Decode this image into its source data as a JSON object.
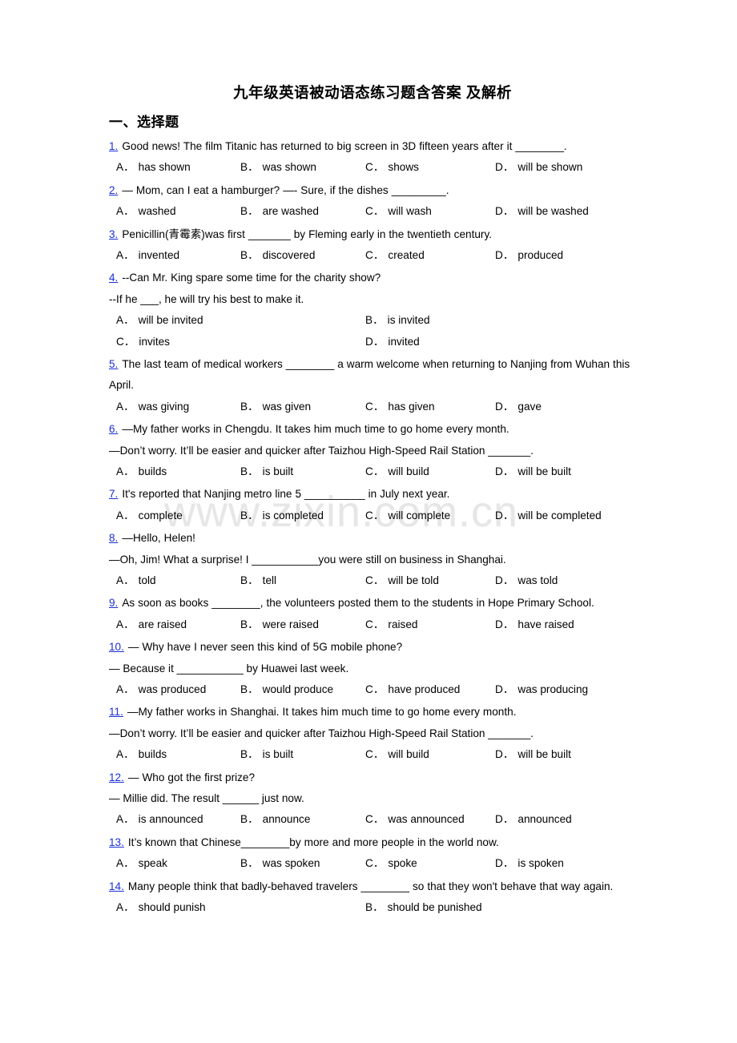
{
  "document": {
    "title": "九年级英语被动语态练习题含答案  及解析",
    "section_heading": "一、选择题",
    "watermark": "www.zixin.com.cn",
    "number_color": "#1b2fd6"
  },
  "questions": [
    {
      "number": "1.",
      "stem": "Good news! The film Titanic has returned to big screen in 3D fifteen years after it ________.",
      "continuation": null,
      "layout": "four-col",
      "options": [
        {
          "label": "A．",
          "text": "has shown"
        },
        {
          "label": "B．",
          "text": "was shown"
        },
        {
          "label": "C．",
          "text": "shows"
        },
        {
          "label": "D．",
          "text": "will be shown"
        }
      ]
    },
    {
      "number": "2.",
      "stem": "— Mom, can I eat a hamburger? —- Sure, if the dishes _________.",
      "continuation": null,
      "layout": "four-col",
      "options": [
        {
          "label": "A．",
          "text": "washed"
        },
        {
          "label": "B．",
          "text": "are washed"
        },
        {
          "label": "C．",
          "text": "will wash"
        },
        {
          "label": "D．",
          "text": "will be washed"
        }
      ]
    },
    {
      "number": "3.",
      "stem": "Penicillin(青霉素)was first _______ by Fleming early in the twentieth century.",
      "continuation": null,
      "layout": "four-col",
      "options": [
        {
          "label": "A．",
          "text": "invented"
        },
        {
          "label": "B．",
          "text": "discovered"
        },
        {
          "label": "C．",
          "text": "created"
        },
        {
          "label": "D．",
          "text": "produced"
        }
      ]
    },
    {
      "number": "4.",
      "stem": "--Can Mr. King spare some time for the charity show?",
      "continuation": "--If he ___, he will try his best to make it.",
      "layout": "two-col",
      "options": [
        {
          "label": "A．",
          "text": "will be invited"
        },
        {
          "label": "B．",
          "text": "is invited"
        },
        {
          "label": "C．",
          "text": "invites"
        },
        {
          "label": "D．",
          "text": "invited"
        }
      ]
    },
    {
      "number": "5.",
      "stem": "The last team of medical workers ________ a warm welcome when returning to Nanjing from Wuhan this April.",
      "continuation": null,
      "layout": "four-col",
      "options": [
        {
          "label": "A．",
          "text": "was giving"
        },
        {
          "label": "B．",
          "text": "was given"
        },
        {
          "label": "C．",
          "text": "has given"
        },
        {
          "label": "D．",
          "text": "gave"
        }
      ]
    },
    {
      "number": "6.",
      "stem": "—My father works in Chengdu. It takes him much time to go home every month.",
      "continuation": "—Don’t worry. It’ll be easier and quicker after Taizhou High-Speed Rail Station _______.",
      "layout": "four-col",
      "options": [
        {
          "label": "A．",
          "text": "builds"
        },
        {
          "label": "B．",
          "text": "is built"
        },
        {
          "label": "C．",
          "text": "will build"
        },
        {
          "label": "D．",
          "text": "will be built"
        }
      ]
    },
    {
      "number": "7.",
      "stem": "It's reported that Nanjing metro line 5 __________ in July next year.",
      "continuation": null,
      "layout": "four-col",
      "options": [
        {
          "label": "A．",
          "text": "complete"
        },
        {
          "label": "B．",
          "text": "is completed"
        },
        {
          "label": "C．",
          "text": "will complete"
        },
        {
          "label": "D．",
          "text": "will be completed"
        }
      ]
    },
    {
      "number": "8.",
      "stem": "—Hello, Helen!",
      "continuation": "—Oh, Jim! What a surprise! I ___________you were still on business in Shanghai.",
      "layout": "four-col",
      "options": [
        {
          "label": "A．",
          "text": "told"
        },
        {
          "label": "B．",
          "text": "tell"
        },
        {
          "label": "C．",
          "text": "will be told"
        },
        {
          "label": "D．",
          "text": "was told"
        }
      ]
    },
    {
      "number": "9.",
      "stem": "As soon as books ________, the volunteers posted them to the students in Hope Primary School.",
      "continuation": null,
      "layout": "four-col",
      "options": [
        {
          "label": "A．",
          "text": "are raised"
        },
        {
          "label": "B．",
          "text": "were raised"
        },
        {
          "label": "C．",
          "text": "raised"
        },
        {
          "label": "D．",
          "text": "have raised"
        }
      ]
    },
    {
      "number": "10.",
      "stem": "— Why have I never seen this kind of 5G mobile phone?",
      "continuation": "— Because it ___________ by Huawei last week.",
      "layout": "four-col",
      "options": [
        {
          "label": "A．",
          "text": "was produced"
        },
        {
          "label": "B．",
          "text": "would produce"
        },
        {
          "label": "C．",
          "text": "have produced"
        },
        {
          "label": "D．",
          "text": "was producing"
        }
      ]
    },
    {
      "number": "11.",
      "stem": "—My father works in Shanghai. It takes him much time to go home every month.",
      "continuation": "—Don’t worry. It’ll be easier and quicker after Taizhou High-Speed Rail Station _______.",
      "layout": "four-col",
      "options": [
        {
          "label": "A．",
          "text": "builds"
        },
        {
          "label": "B．",
          "text": "is built"
        },
        {
          "label": "C．",
          "text": "will build"
        },
        {
          "label": "D．",
          "text": "will be built"
        }
      ]
    },
    {
      "number": "12.",
      "stem": "— Who got the first prize?",
      "continuation": "— Millie did. The result ______ just now.",
      "layout": "four-col",
      "options": [
        {
          "label": "A．",
          "text": "is announced"
        },
        {
          "label": "B．",
          "text": "announce"
        },
        {
          "label": "C．",
          "text": "was announced"
        },
        {
          "label": "D．",
          "text": "announced"
        }
      ]
    },
    {
      "number": "13.",
      "stem": "It’s known that Chinese________by more and more people in the world now.",
      "continuation": null,
      "layout": "four-col",
      "options": [
        {
          "label": "A．",
          "text": "speak"
        },
        {
          "label": "B．",
          "text": "was spoken"
        },
        {
          "label": "C．",
          "text": "spoke"
        },
        {
          "label": "D．",
          "text": "is spoken"
        }
      ]
    },
    {
      "number": "14.",
      "stem": "Many people think that badly-behaved travelers ________ so that they won't behave that way again.",
      "continuation": null,
      "layout": "two-col",
      "options": [
        {
          "label": "A．",
          "text": "should punish"
        },
        {
          "label": "B．",
          "text": "should be punished"
        }
      ]
    }
  ]
}
